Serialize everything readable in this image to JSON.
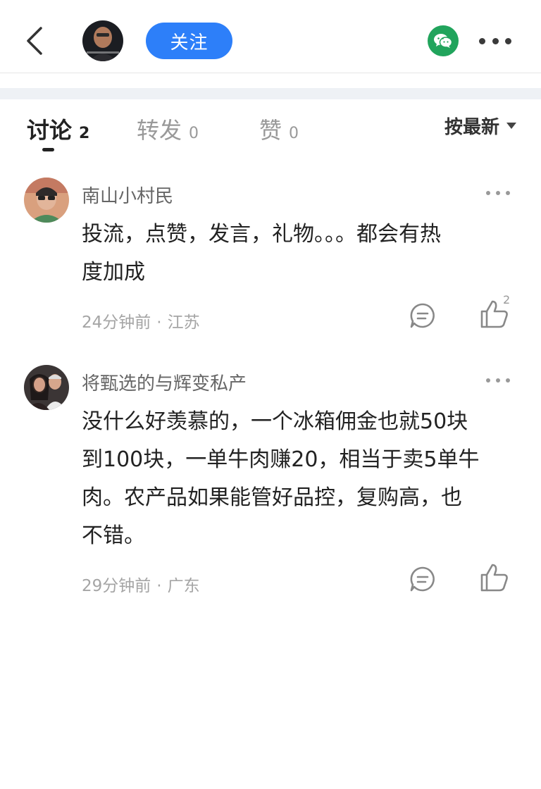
{
  "header": {
    "back_icon": "chevron-left-icon",
    "author_avatar_icon": "author-avatar",
    "follow_label": "关注",
    "share_icon": "wechat-icon",
    "more_icon": "more-horizontal-icon",
    "accent_color": "#2d7ff9",
    "wechat_color": "#21a45c"
  },
  "tabs": [
    {
      "label": "讨论",
      "count": "2",
      "active": true
    },
    {
      "label": "转发",
      "count": "0",
      "active": false
    },
    {
      "label": "赞",
      "count": "0",
      "active": false
    }
  ],
  "sort": {
    "label": "按最新",
    "icon": "caret-down-icon"
  },
  "comments": [
    {
      "user": "南山小村民",
      "text_lines": [
        "投流，点赞，发言，礼物。。。都会有热",
        "度加成"
      ],
      "time": "24分钟前",
      "region": "江苏",
      "separator": "·",
      "like_count": "2"
    },
    {
      "user": "将甄选的与辉变私产",
      "text_lines": [
        "没什么好羡慕的，一个冰箱佣金也就50块",
        "到100块，一单牛肉赚20，相当于卖5单牛",
        "肉。农产品如果能管好品控，复购高，也",
        "不错。"
      ],
      "time": "29分钟前",
      "region": "广东",
      "separator": "·",
      "like_count": ""
    }
  ]
}
